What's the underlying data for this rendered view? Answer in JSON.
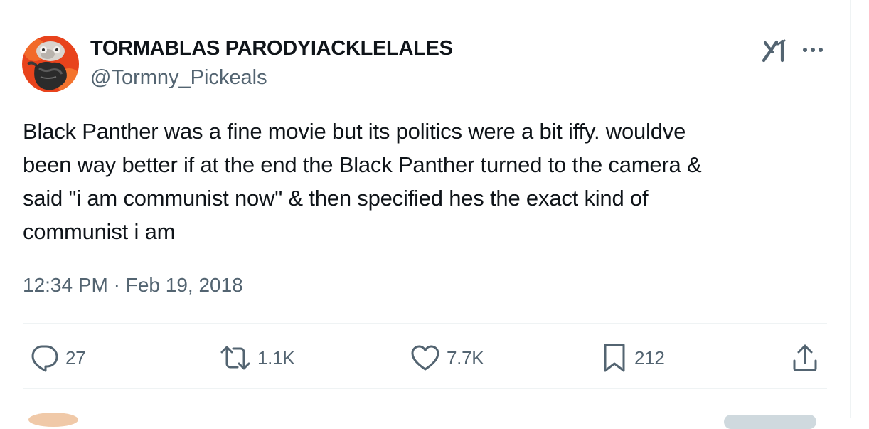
{
  "author": {
    "display_name": "TORMABLAS PARODYIACKLELALES",
    "handle": "@Tormny_Pickeals"
  },
  "icons": {
    "grok": "grok-icon",
    "more": "more-icon",
    "reply": "reply-icon",
    "retweet": "retweet-icon",
    "like": "heart-icon",
    "bookmark": "bookmark-icon",
    "share": "share-icon"
  },
  "tweet": {
    "text": "Black Panther was a fine movie but its politics were a bit iffy. wouldve\nbeen way better if at the end the Black Panther turned to the camera &\nsaid \"i am communist now\" & then specified hes the exact kind of\ncommunist i am",
    "timestamp": "12:34 PM · Feb 19, 2018"
  },
  "actions": {
    "replies": "27",
    "retweets": "1.1K",
    "likes": "7.7K",
    "bookmarks": "212"
  },
  "colors": {
    "text": "#0f1419",
    "secondary": "#536471",
    "divider": "#eff3f4",
    "avatar_background": "#e8431c"
  }
}
